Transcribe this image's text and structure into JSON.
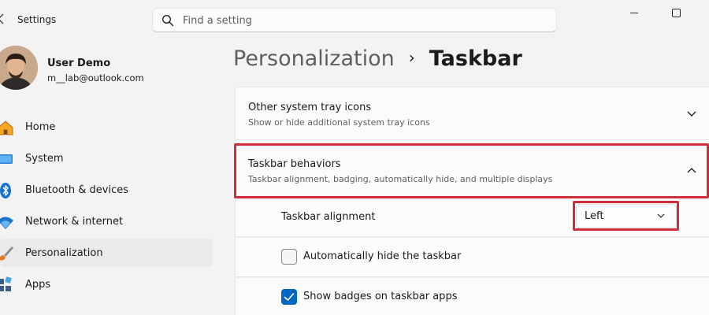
{
  "window": {
    "app_title": "Settings"
  },
  "search": {
    "placeholder": "Find a setting"
  },
  "profile": {
    "name": "User Demo",
    "email": "m__lab@outlook.com"
  },
  "nav": {
    "items": [
      {
        "label": "Home",
        "icon": "home-icon",
        "active": false
      },
      {
        "label": "System",
        "icon": "monitor-icon",
        "active": false
      },
      {
        "label": "Bluetooth & devices",
        "icon": "bluetooth-icon",
        "active": false
      },
      {
        "label": "Network & internet",
        "icon": "wifi-icon",
        "active": false
      },
      {
        "label": "Personalization",
        "icon": "paintbrush-icon",
        "active": true
      },
      {
        "label": "Apps",
        "icon": "apps-icon",
        "active": false
      }
    ]
  },
  "breadcrumb": {
    "parent": "Personalization",
    "separator": "›",
    "current": "Taskbar"
  },
  "sections": {
    "tray_icons": {
      "title": "Other system tray icons",
      "description": "Show or hide additional system tray icons",
      "expanded": false
    },
    "behaviors": {
      "title": "Taskbar behaviors",
      "description": "Taskbar alignment, badging, automatically hide, and multiple displays",
      "expanded": true
    }
  },
  "behaviors": {
    "alignment_label": "Taskbar alignment",
    "alignment_value": "Left",
    "autohide_label": "Automatically hide the taskbar",
    "autohide_checked": false,
    "badges_label": "Show badges on taskbar apps",
    "badges_checked": true
  },
  "colors": {
    "accent": "#0067c0",
    "highlight": "#d02d3a"
  }
}
